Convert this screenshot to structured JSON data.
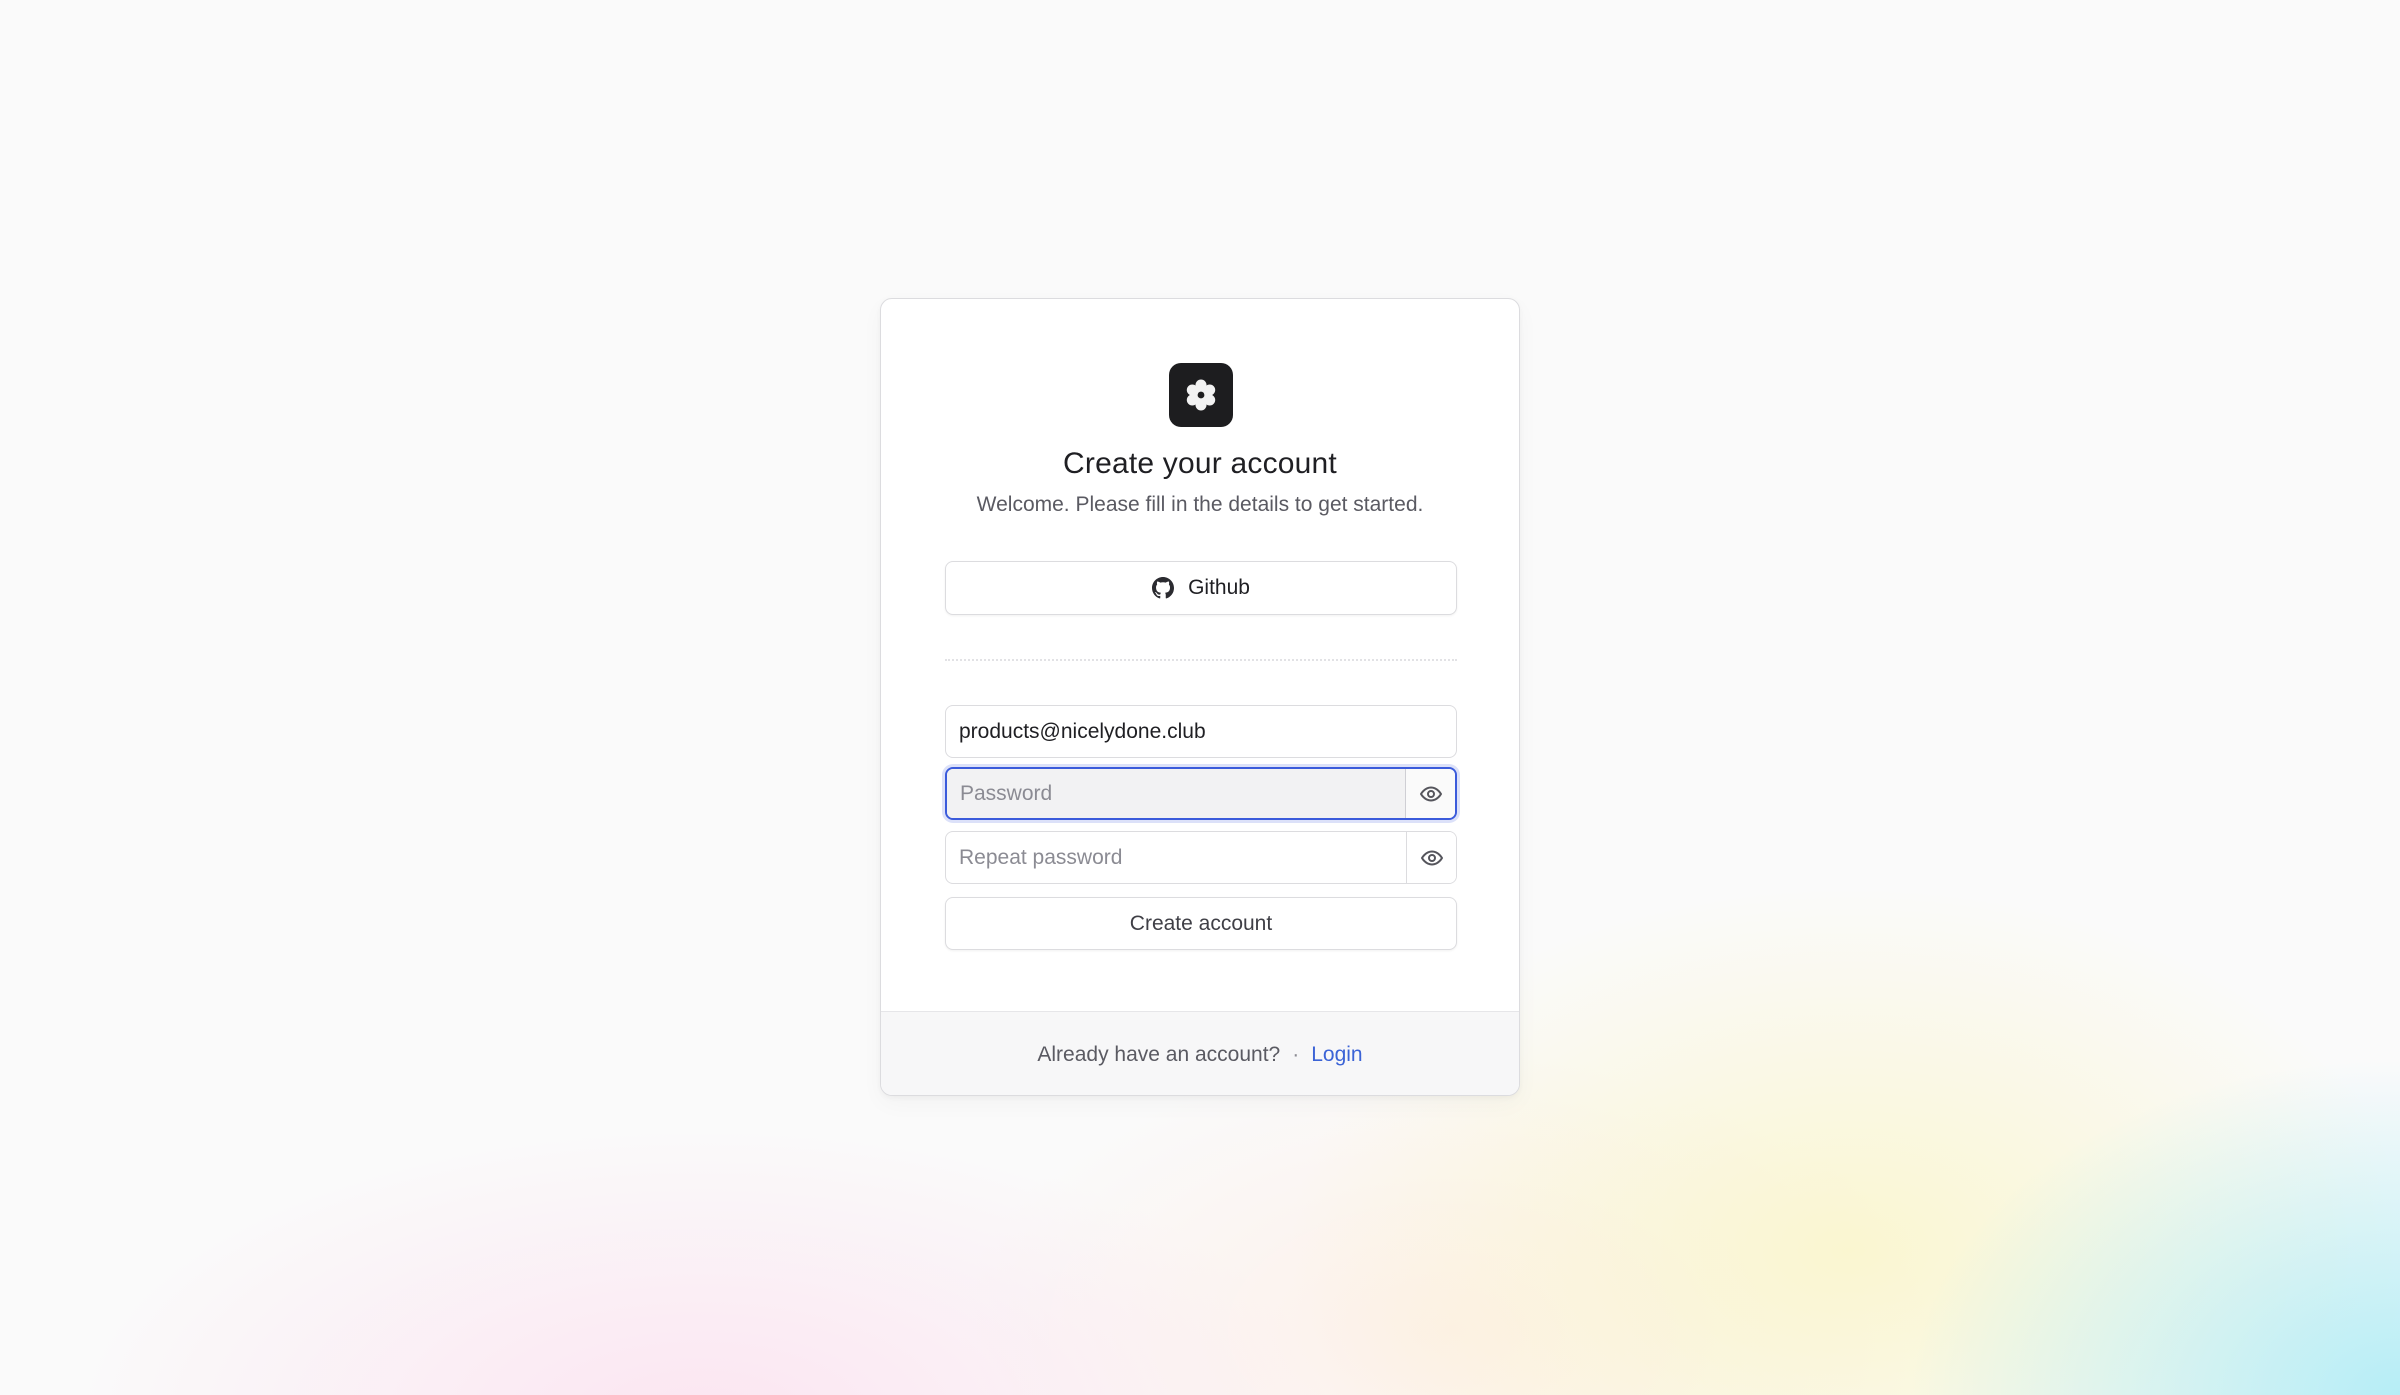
{
  "header": {
    "title": "Create your account",
    "subtitle": "Welcome. Please fill in the details to get started."
  },
  "social": {
    "github_label": "Github"
  },
  "form": {
    "email_value": "products@nicelydone.club",
    "password_placeholder": "Password",
    "repeat_password_placeholder": "Repeat password",
    "submit_label": "Create account"
  },
  "footer": {
    "prompt": "Already have an account?",
    "separator": "·",
    "login_label": "Login"
  },
  "colors": {
    "accent": "#3b5bdb",
    "link": "#3b63d6",
    "logo_bg": "#1d1d1f"
  },
  "icons": {
    "logo": "flower-logo-icon",
    "github": "github-icon",
    "show_password": "eye-icon"
  }
}
